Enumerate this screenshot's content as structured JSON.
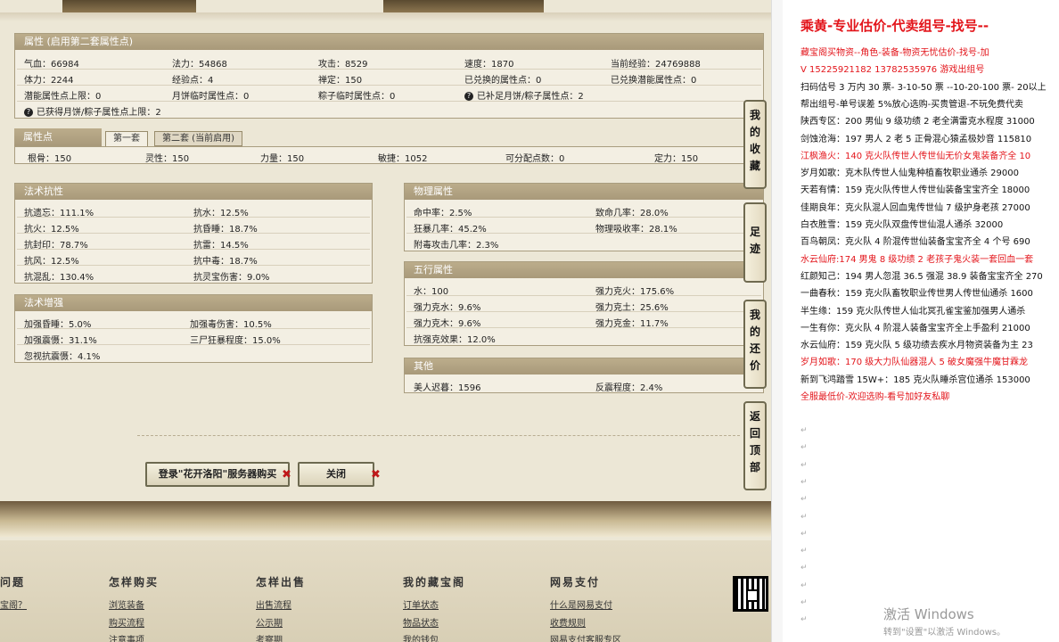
{
  "attr_panel": {
    "title": "属性 (启用第二套属性点)",
    "row1": [
      "气血：66984",
      "法力：54868",
      "攻击：8529",
      "速度：1870",
      "当前经验：24769888"
    ],
    "row2": [
      "体力：2244",
      "经验点：4",
      "禅定：150",
      "已兑换的属性点：0",
      "已兑换潜能属性点：0"
    ],
    "row3": [
      "潜能属性点上限：0",
      "月饼临时属性点：0",
      "粽子临时属性点：0",
      "已补足月饼/粽子属性点：2"
    ],
    "row4": "已获得月饼/粽子属性点上限：2"
  },
  "points_panel": {
    "title": "属性点",
    "tab1": "第一套",
    "tab2": "第二套 (当前启用)",
    "values": [
      "根骨：150",
      "灵性：150",
      "力量：150",
      "敏捷：1052",
      "可分配点数：0",
      "定力：150"
    ]
  },
  "magic_res": {
    "title": "法术抗性",
    "left": [
      "抗遗忘：111.1%",
      "抗火：12.5%",
      "抗封印：78.7%",
      "抗风：12.5%",
      "抗混乱：130.4%"
    ],
    "right": [
      "抗水：12.5%",
      "抗昏睡：18.7%",
      "抗雷：14.5%",
      "抗中毒：18.7%",
      "抗灵宝伤害：9.0%"
    ]
  },
  "magic_boost": {
    "title": "法术增强",
    "left": [
      "加强昏睡：5.0%",
      "加强震慑：31.1%",
      "忽视抗震慑：4.1%"
    ],
    "right": [
      "加强毒伤害：10.5%",
      "三尸狂暴程度：15.0%"
    ]
  },
  "physical": {
    "title": "物理属性",
    "left": [
      "命中率：2.5%",
      "狂暴几率：45.2%",
      "附毒攻击几率：2.3%"
    ],
    "right": [
      "致命几率：28.0%",
      "物理吸收率：28.1%"
    ]
  },
  "five": {
    "title": "五行属性",
    "left": [
      "水：100",
      "强力克水：9.6%",
      "强力克木：9.6%",
      "抗强克效果：12.0%"
    ],
    "right": [
      "强力克火：175.6%",
      "强力克土：25.6%",
      "强力克金：11.7%"
    ]
  },
  "other": {
    "title": "其他",
    "left": [
      "美人迟暮：1596"
    ],
    "right": [
      "反震程度：2.4%"
    ]
  },
  "buttons": {
    "login": "登录\"花开洛阳\"服务器购买",
    "close": "关闭"
  },
  "sidetabs": [
    [
      "我",
      "的",
      "收",
      "藏"
    ],
    [
      "足",
      "迹"
    ],
    [
      "我",
      "的",
      "还",
      "价"
    ],
    [
      "返",
      "回",
      "顶",
      "部"
    ]
  ],
  "footer": {
    "cols": [
      "问题",
      "怎样购买",
      "怎样出售",
      "我的藏宝阁",
      "网易支付"
    ],
    "links": [
      [
        "宝阁？"
      ],
      [
        "浏览装备",
        "购买流程",
        "注意事项"
      ],
      [
        "出售流程",
        "公示期",
        "考察期"
      ],
      [
        "订单状态",
        "物品状态",
        "我的钱包"
      ],
      [
        "什么是网易支付",
        "收费规则",
        "网易支付客服专区"
      ]
    ]
  },
  "notes": {
    "title": "乘黄-专业估价-代卖组号-找号--",
    "lines": [
      {
        "t": "藏宝阁买物资--角色-装备-物资无忧估价-找号-加",
        "red": true
      },
      {
        "t": "V 15225921182   13782535976 游戏出组号",
        "red": true
      },
      {
        "t": "扫码估号 3 万内 30 票- 3-10-50 票  --10-20-100 票- 20以上",
        "red": false
      },
      {
        "t": "帮出组号-单号误差 5%放心选购-买贵管退-不玩免费代卖",
        "red": false
      },
      {
        "t": "陕西专区：200 男仙 9 级功绩 2 老全满雷克水程度 31000",
        "red": false
      },
      {
        "t": "剑蚀沧海：197 男人 2 老 5 正骨混心猿孟极妙音 115810",
        "red": false
      },
      {
        "t": "江枫渔火：140 克火队传世人传世仙无价女鬼装备齐全 10",
        "red": true
      },
      {
        "t": "岁月如歌：克木队传世人仙鬼种植畜牧职业通杀 29000",
        "red": false
      },
      {
        "t": "天若有情：159 克火队传世人传世仙装备宝宝齐全 18000",
        "red": false
      },
      {
        "t": "佳期良年：克火队混人回血鬼传世仙 7 级护身老孩 27000",
        "red": false
      },
      {
        "t": "白衣胜雪：159 克火队双盘传世仙混人通杀 32000",
        "red": false
      },
      {
        "t": "百鸟朝凤：克火队 4 阶混传世仙装备宝宝齐全 4 个号 690",
        "red": false
      },
      {
        "t": "水云仙府:174 男鬼 8 级功绩 2 老孩子鬼火装一套回血一套",
        "red": true
      },
      {
        "t": "红颜知己：194 男人忽混 36.5 强混 38.9 装备宝宝齐全 270",
        "red": false
      },
      {
        "t": "一曲春秋：159 克火队畜牧职业传世男人传世仙通杀 1600",
        "red": false
      },
      {
        "t": "半生缘：159 克火队传世人仙北冥孔雀宝鉴加强男人通杀",
        "red": false
      },
      {
        "t": "一生有你：克火队 4 阶混人装备宝宝齐全上手盈利 21000",
        "red": false
      },
      {
        "t": "水云仙府：159 克火队 5 级功绩去疾水月物资装备为主 23",
        "red": false
      },
      {
        "t": "岁月如歌：170 级大力队仙器混人 5 破女魔强牛魔甘霖龙",
        "red": true
      },
      {
        "t": "新到飞鸿踏雪 15W+：185 克火队睡杀宫位通杀 153000",
        "red": false
      },
      {
        "t": "全服最低价-欢迎选购-看号加好友私聊",
        "red": true
      }
    ],
    "watermark1": "激活 Windows",
    "watermark2": "转到\"设置\"以激活 Windows。"
  }
}
